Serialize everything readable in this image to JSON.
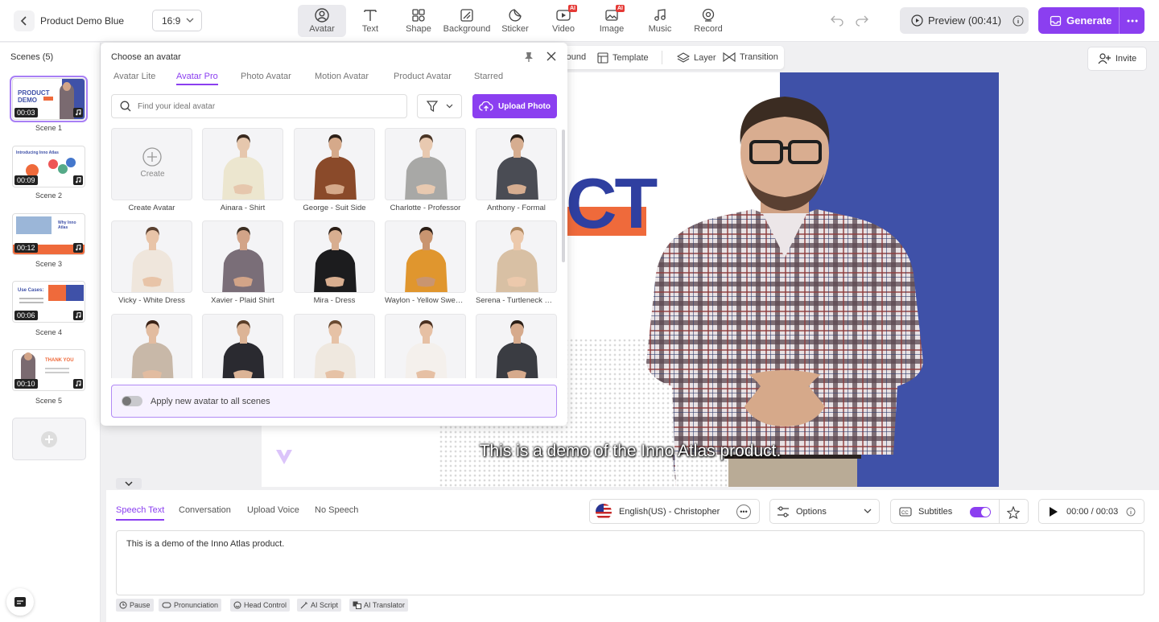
{
  "header": {
    "project_title": "Product Demo Blue",
    "ratio": "16:9",
    "tools": [
      {
        "label": "Avatar",
        "icon": "avatar-icon",
        "active": true
      },
      {
        "label": "Text",
        "icon": "text-icon"
      },
      {
        "label": "Shape",
        "icon": "shape-icon"
      },
      {
        "label": "Background",
        "icon": "background-icon"
      },
      {
        "label": "Sticker",
        "icon": "sticker-icon"
      },
      {
        "label": "Video",
        "icon": "video-icon",
        "badge": "AI"
      },
      {
        "label": "Image",
        "icon": "image-icon",
        "badge": "AI"
      },
      {
        "label": "Music",
        "icon": "music-icon"
      },
      {
        "label": "Record",
        "icon": "record-icon"
      }
    ],
    "preview_label": "Preview (00:41)",
    "generate_label": "Generate"
  },
  "sidebar": {
    "title": "Scenes (5)",
    "scenes": [
      {
        "label": "Scene 1",
        "duration": "00:03",
        "thumb_text": "PRODUCT DEMO"
      },
      {
        "label": "Scene 2",
        "duration": "00:09",
        "thumb_text": "Introducing Inno Atlas"
      },
      {
        "label": "Scene 3",
        "duration": "00:12",
        "thumb_text": "Why Inno Atlas"
      },
      {
        "label": "Scene 4",
        "duration": "00:06",
        "thumb_text": "Use Cases:"
      },
      {
        "label": "Scene 5",
        "duration": "00:10",
        "thumb_text": "THANK YOU"
      }
    ]
  },
  "secondary_toolbar": {
    "background": "round",
    "template": "Template",
    "layer": "Layer",
    "transition": "Transition"
  },
  "invite_label": "Invite",
  "avatar_panel": {
    "title": "Choose an avatar",
    "tabs": [
      "Avatar Lite",
      "Avatar Pro",
      "Photo Avatar",
      "Motion Avatar",
      "Product Avatar",
      "Starred"
    ],
    "active_tab": "Avatar Pro",
    "search_placeholder": "Find your ideal avatar",
    "upload_label": "Upload Photo",
    "create_label": "Create",
    "avatars": [
      {
        "name": "Create Avatar",
        "type": "create"
      },
      {
        "name": "Ainara - Shirt",
        "top": "#ece6cf",
        "skin": "#e6c7ad",
        "hair": "#3a2a20",
        "bottom": "#2a2a2a"
      },
      {
        "name": "George - Suit Side",
        "top": "#8a4a2a",
        "skin": "#d5a98a",
        "hair": "#2c2018",
        "bottom": "#2a2a2a"
      },
      {
        "name": "Charlotte - Professor",
        "top": "#a8a8a6",
        "skin": "#e8c9b0",
        "hair": "#4a3526",
        "bottom": "#333"
      },
      {
        "name": "Anthony - Formal",
        "top": "#4a4c54",
        "skin": "#d6ad90",
        "hair": "#2a1e16",
        "bottom": "#2a2a2a"
      },
      {
        "name": "Vicky - White Dress",
        "top": "#efe6dc",
        "skin": "#e8c4a8",
        "hair": "#5a4030",
        "bottom": "#efe6dc"
      },
      {
        "name": "Xavier - Plaid Shirt",
        "top": "#7a6e78",
        "skin": "#d2a488",
        "hair": "#3c2e22",
        "bottom": "#333"
      },
      {
        "name": "Mira - Dress",
        "top": "#1c1c1e",
        "skin": "#d8ae90",
        "hair": "#2a1d15",
        "bottom": "#1c1c1e"
      },
      {
        "name": "Waylon - Yellow Sweater",
        "top": "#e0962e",
        "skin": "#c99570",
        "hair": "#2a1d15",
        "bottom": "#333"
      },
      {
        "name": "Serena - Turtleneck Shirt",
        "top": "#d8c0a4",
        "skin": "#ecc9ac",
        "hair": "#b08860",
        "bottom": "#d8c0a4"
      },
      {
        "name": "",
        "top": "#c8b8a8",
        "skin": "#e2bca0",
        "hair": "#3a2216",
        "bottom": "#333"
      },
      {
        "name": "",
        "top": "#2a2a30",
        "skin": "#dcb496",
        "hair": "#5a3e28",
        "bottom": "#222"
      },
      {
        "name": "",
        "top": "#efe8df",
        "skin": "#e6c2a6",
        "hair": "#6a4a30",
        "bottom": "#333"
      },
      {
        "name": "",
        "top": "#f4f0ec",
        "skin": "#e6c0a4",
        "hair": "#4a3020",
        "bottom": "#222"
      },
      {
        "name": "",
        "top": "#3a3c42",
        "skin": "#d6aa8c",
        "hair": "#2a1e16",
        "bottom": "#222"
      }
    ],
    "apply_label": "Apply new avatar to all scenes"
  },
  "canvas": {
    "big_text": "CT",
    "subtitle": "This is a demo of the Inno Atlas product.",
    "colors": {
      "blue": "#3f51a8",
      "orange": "#ef6a3b"
    }
  },
  "bottom": {
    "tabs": [
      "Speech Text",
      "Conversation",
      "Upload Voice",
      "No Speech"
    ],
    "active_tab": "Speech Text",
    "voice": "English(US) - Christopher",
    "options_label": "Options",
    "subtitles_label": "Subtitles",
    "subtitles_on": true,
    "time": "00:00 / 00:03",
    "speech_text": "This is a demo of the Inno Atlas product.",
    "chips": [
      "Pause",
      "Pronunciation",
      "Head Control",
      "AI Script",
      "AI Translator"
    ]
  },
  "accent_color": "#8b3ff0"
}
